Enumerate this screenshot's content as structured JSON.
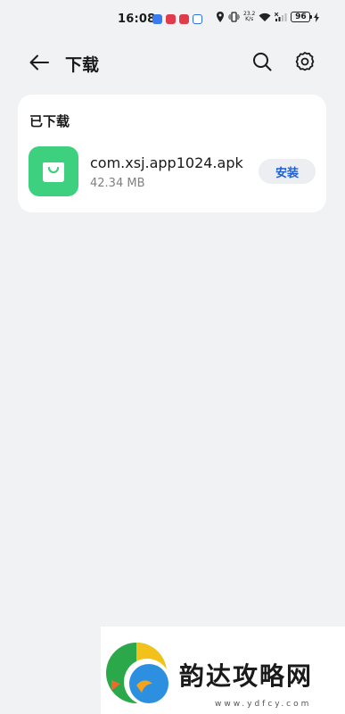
{
  "status_bar": {
    "time": "16:08",
    "net_speed_value": "23.2",
    "net_speed_unit": "K/s",
    "battery": "96",
    "notification_colors": [
      "#3b7bf0",
      "#e03b4b",
      "#e03b4b",
      "#2f6fe0"
    ]
  },
  "header": {
    "title": "下载"
  },
  "downloaded_section": {
    "title": "已下载",
    "items": [
      {
        "file_name": "com.xsj.app1024.apk",
        "size": "42.34 MB",
        "action_label": "安装",
        "icon": "shopping-bag-icon",
        "icon_color": "#3dd07f"
      }
    ]
  },
  "watermark": {
    "text": "韵达攻略网",
    "url": "www.ydfcy.com"
  },
  "colors": {
    "background": "#f1f2f4",
    "card": "#ffffff",
    "accent": "#1f5fcf"
  }
}
